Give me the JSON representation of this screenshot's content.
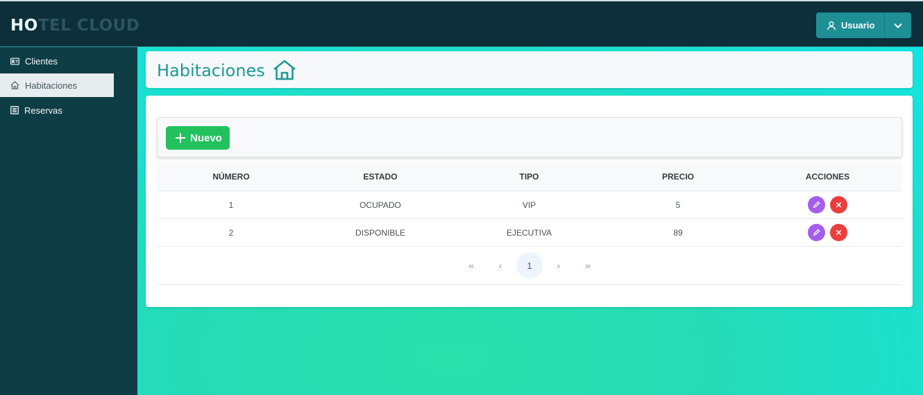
{
  "app": {
    "brand_first": "HO",
    "brand_rest": "TEL CLOUD"
  },
  "user_menu": {
    "label": "Usuario"
  },
  "sidebar": {
    "items": [
      {
        "label": "Clientes",
        "icon": "id-card-icon"
      },
      {
        "label": "Habitaciones",
        "icon": "home-icon",
        "active": true
      },
      {
        "label": "Reservas",
        "icon": "list-icon"
      }
    ]
  },
  "page": {
    "title": "Habitaciones"
  },
  "toolbar": {
    "new_label": "Nuevo"
  },
  "table": {
    "columns": [
      "NÚMERO",
      "ESTADO",
      "TIPO",
      "PRECIO",
      "ACCIONES"
    ],
    "rows": [
      {
        "numero": "1",
        "estado": "OCUPADO",
        "tipo": "VIP",
        "precio": "5"
      },
      {
        "numero": "2",
        "estado": "DISPONIBLE",
        "tipo": "EJECUTIVA",
        "precio": "89"
      }
    ]
  },
  "pagination": {
    "first": "«",
    "prev": "‹",
    "current": "1",
    "next": "›",
    "last": "»"
  },
  "colors": {
    "topbar": "#0c2f3a",
    "sidebar": "#0f3d46",
    "accent": "#1e9a94",
    "new_button": "#22c15e",
    "edit_button": "#a55eea",
    "delete_button": "#ec3d3d"
  }
}
